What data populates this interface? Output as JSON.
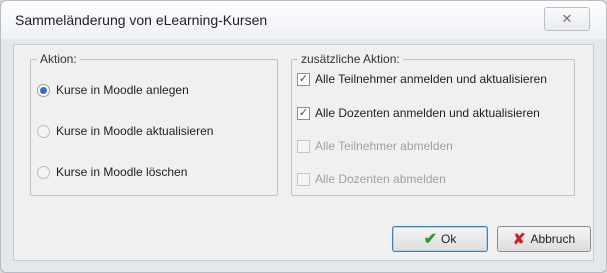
{
  "window": {
    "title": "Sammeländerung von eLearning-Kursen",
    "close_glyph": "✕"
  },
  "left_group": {
    "label": "Aktion:",
    "options": [
      {
        "label": "Kurse in Moodle anlegen",
        "checked": true
      },
      {
        "label": "Kurse in Moodle aktualisieren",
        "checked": false
      },
      {
        "label": "Kurse in Moodle löschen",
        "checked": false
      }
    ]
  },
  "right_group": {
    "label": "zusätzliche Aktion:",
    "checkboxes": [
      {
        "label": "Alle Teilnehmer anmelden und aktualisieren",
        "checked": true,
        "enabled": true
      },
      {
        "label": "Alle Dozenten anmelden und aktualisieren",
        "checked": true,
        "enabled": true
      },
      {
        "label": "Alle Teilnehmer abmelden",
        "checked": false,
        "enabled": false
      },
      {
        "label": "Alle Dozenten abmelden",
        "checked": false,
        "enabled": false
      }
    ]
  },
  "buttons": {
    "ok": "Ok",
    "cancel": "Abbruch"
  },
  "icons": {
    "ok": "checkmark-icon",
    "cancel": "x-icon",
    "close": "close-icon"
  },
  "colors": {
    "ok_icon": "#2e9a2e",
    "cancel_icon": "#cc2222",
    "radio_accent": "#3b6fbf"
  }
}
